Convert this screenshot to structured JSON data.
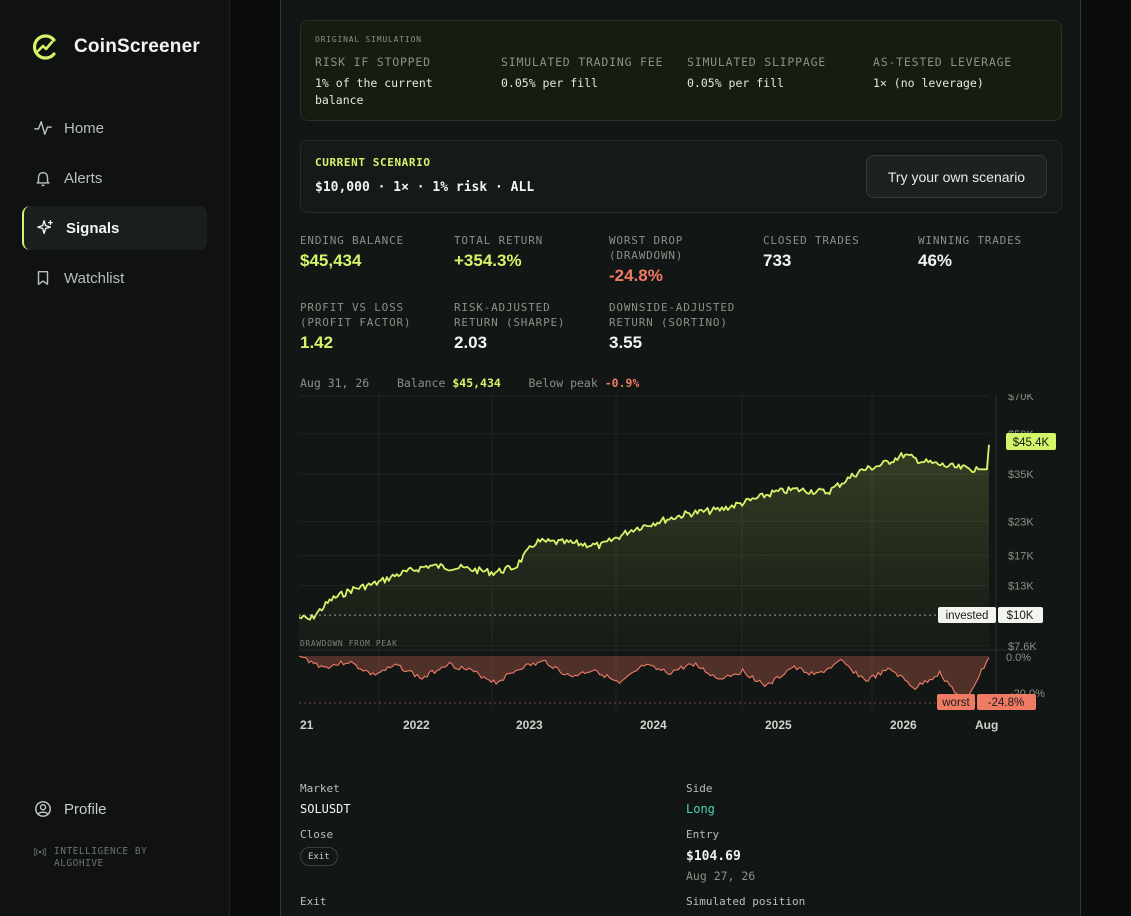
{
  "brand": {
    "name": "CoinScreener",
    "accent": "#d4f56a"
  },
  "nav": {
    "items": [
      {
        "label": "Home",
        "icon": "activity-icon",
        "active": false
      },
      {
        "label": "Alerts",
        "icon": "bell-icon",
        "active": false
      },
      {
        "label": "Signals",
        "icon": "sparkle-icon",
        "active": true
      },
      {
        "label": "Watchlist",
        "icon": "bookmark-icon",
        "active": false
      }
    ],
    "profile": "Profile",
    "powered_by": "INTELLIGENCE BY ALGOHIVE"
  },
  "original_simulation": {
    "title": "ORIGINAL SIMULATION",
    "risk_label": "RISK IF STOPPED",
    "risk_value": "1% of the current balance",
    "fee_label": "SIMULATED TRADING FEE",
    "fee_value": "0.05% per fill",
    "slippage_label": "SIMULATED SLIPPAGE",
    "slippage_value": "0.05% per fill",
    "leverage_label": "AS-TESTED LEVERAGE",
    "leverage_value": "1× (no leverage)"
  },
  "scenario": {
    "label": "CURRENT SCENARIO",
    "value": "$10,000 · 1× · 1% risk · ALL",
    "button": "Try your own scenario"
  },
  "stats": {
    "ending_balance_label": "ENDING BALANCE",
    "ending_balance": "$45,434",
    "total_return_label": "TOTAL RETURN",
    "total_return": "+354.3%",
    "worst_drop_label": "WORST DROP (DRAWDOWN)",
    "worst_drop": "-24.8%",
    "closed_trades_label": "CLOSED TRADES",
    "closed_trades": "733",
    "winning_trades_label": "WINNING TRADES",
    "winning_trades": "46%",
    "profit_factor_label": "PROFIT VS LOSS (PROFIT FACTOR)",
    "profit_factor": "1.42",
    "sharpe_label": "RISK-ADJUSTED RETURN (SHARPE)",
    "sharpe": "2.03",
    "sortino_label": "DOWNSIDE-ADJUSTED RETURN (SORTINO)",
    "sortino": "3.55"
  },
  "hover": {
    "date": "Aug 31, 26",
    "balance_label": "Balance",
    "balance": "$45,434",
    "below_label": "Below peak",
    "below": "-0.9%"
  },
  "chart_data": {
    "type": "area",
    "y_scale": "log",
    "y_ticks": [
      "$70K",
      "$50K",
      "$35K",
      "$23K",
      "$17K",
      "$13K",
      "$7.6K"
    ],
    "y_tick_values": [
      70000,
      50000,
      35000,
      23000,
      17000,
      13000,
      7600
    ],
    "x_ticks": [
      "21",
      "2022",
      "2023",
      "2024",
      "2025",
      "2026",
      "Aug"
    ],
    "ylim": [
      7600,
      70000
    ],
    "series": [
      {
        "x": [
          "2021-05",
          "2021-06",
          "2021-08",
          "2021-10",
          "2021-12",
          "2022-02",
          "2022-05",
          "2022-08",
          "2022-11",
          "2023-01",
          "2023-03",
          "2023-06",
          "2023-09",
          "2023-12",
          "2024-02",
          "2024-05",
          "2024-08",
          "2024-11",
          "2025-01",
          "2025-03",
          "2025-06",
          "2025-09",
          "2025-11",
          "2026-01",
          "2026-03",
          "2026-06",
          "2026-08",
          "2026-08-31"
        ],
        "values": [
          9800,
          9600,
          11500,
          12600,
          13200,
          14300,
          15500,
          15200,
          14600,
          15300,
          19200,
          19000,
          18500,
          21500,
          22800,
          24600,
          25500,
          27800,
          29700,
          30500,
          29800,
          36000,
          38000,
          41500,
          39000,
          37000,
          36500,
          45434
        ]
      }
    ],
    "invested_label": "invested",
    "invested_value": "$10K",
    "current_label": "$45.4K",
    "drawdown": {
      "title": "DRAWDOWN FROM PEAK",
      "y_ticks": [
        "0.0%",
        "-20.0%"
      ],
      "values": [
        0,
        -6,
        -3,
        -10,
        -5,
        -12,
        -4,
        -8,
        -14,
        -6,
        -3,
        -11,
        -7,
        -15,
        -5,
        -9,
        -4,
        -12,
        -8,
        -16,
        -6,
        -10,
        -3,
        -13,
        -7,
        -17,
        -9,
        -24.8,
        -0.9
      ],
      "worst_label": "worst",
      "worst_value": "-24.8%"
    }
  },
  "details": {
    "market_label": "Market",
    "market": "SOLUSDT",
    "side_label": "Side",
    "side": "Long",
    "close_label": "Close",
    "close_pill": "Exit",
    "entry_label": "Entry",
    "entry_price": "$104.69",
    "entry_date": "Aug 27, 26",
    "exit_label": "Exit",
    "position_label": "Simulated position"
  }
}
